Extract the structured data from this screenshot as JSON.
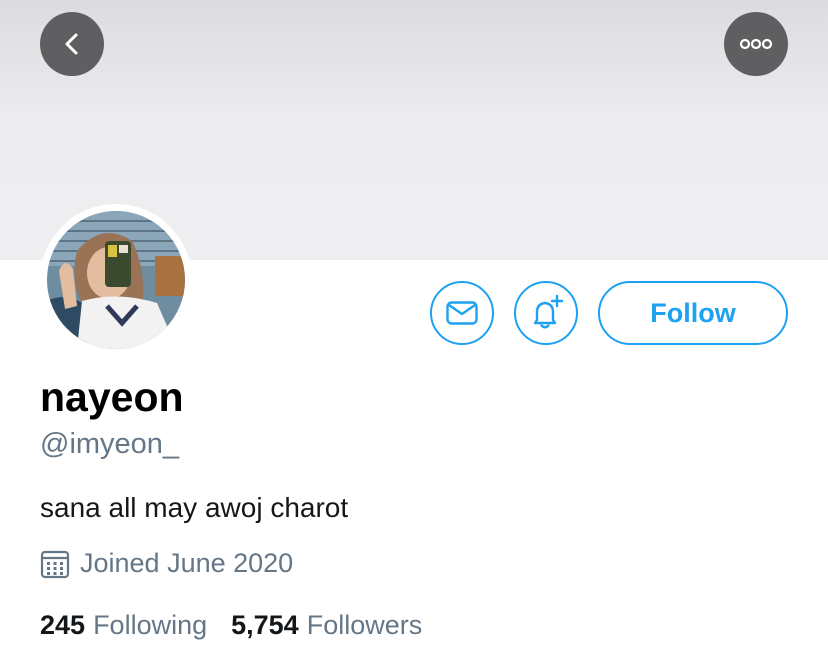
{
  "header": {
    "back_icon": "chevron-left-icon",
    "more_icon": "ellipsis-icon"
  },
  "profile": {
    "display_name": "nayeon",
    "handle": "@imyeon_",
    "bio": "sana all may awoj charot",
    "joined": "Joined June 2020",
    "following_count": "245",
    "following_label": "Following",
    "followers_count": "5,754",
    "followers_label": "Followers"
  },
  "actions": {
    "message_icon": "envelope-icon",
    "notify_icon": "bell-plus-icon",
    "follow_label": "Follow"
  },
  "colors": {
    "accent": "#1da1f2",
    "secondary_text": "#657786",
    "banner": "#ececee",
    "overlay_button": "#5f5f62"
  }
}
